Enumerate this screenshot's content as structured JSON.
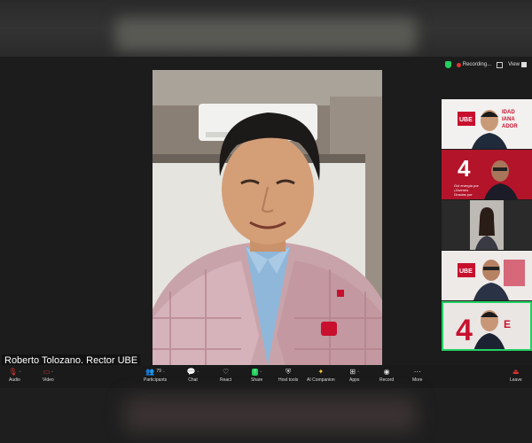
{
  "speaker": {
    "name": "Roberto Tolozano. Rector UBE",
    "badge": "UBE"
  },
  "topbar": {
    "recording_label": "Recording...",
    "view_label": "View"
  },
  "thumbnails": [
    {
      "logo": "UBE",
      "text": [
        "IDAD",
        "IANA",
        "ADOR"
      ]
    },
    {
      "logo": "4",
      "text": [
        "Gol energía por",
        "¡Jóvenes",
        "Gracias por"
      ]
    },
    {
      "logo": "",
      "text": []
    },
    {
      "logo": "UBE",
      "text": []
    },
    {
      "logo": "4",
      "text": [
        "E"
      ]
    }
  ],
  "toolbar": {
    "audio": "Audio",
    "video": "Video",
    "participants": "Participants",
    "participants_count": "79",
    "chat": "Chat",
    "react": "React",
    "share": "Share",
    "host_tools": "Host tools",
    "ai_companion": "AI Companion",
    "apps": "Apps",
    "record": "Record",
    "more": "More",
    "leave": "Leave"
  },
  "colors": {
    "accent_green": "#23d160",
    "record_red": "#e0342e",
    "ube_red": "#c8102e"
  }
}
